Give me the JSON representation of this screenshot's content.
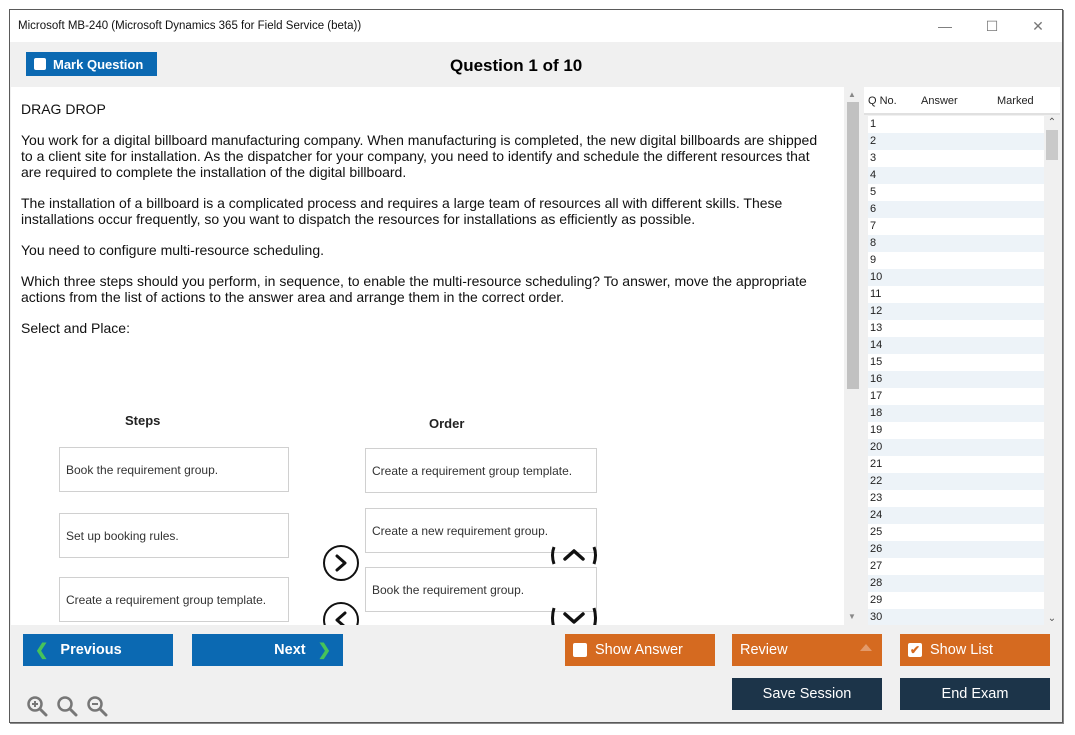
{
  "window": {
    "title": "Microsoft MB-240 (Microsoft Dynamics 365 for Field Service (beta))",
    "controls": {
      "minimize": "—",
      "maximize": "☐",
      "close": "✕"
    }
  },
  "header": {
    "mark_question_label": "Mark Question",
    "question_counter": "Question 1 of 10"
  },
  "question": {
    "type": "DRAG DROP",
    "paragraphs": [
      "You work for a digital billboard manufacturing company. When manufacturing is completed, the new digital billboards are shipped to a client site for installation. As the dispatcher for your company, you need to identify and schedule the different resources that are required to complete the installation of the digital billboard.",
      "The installation of a billboard is a complicated process and requires a large team of resources all with different skills. These installations occur frequently, so you want to dispatch the resources for installations as efficiently as possible.",
      "You need to configure multi-resource scheduling.",
      "Which three steps should you perform, in sequence, to enable the multi-resource scheduling? To answer, move the appropriate actions from the list of actions to the answer area and arrange them in the correct order.",
      "Select and Place:"
    ]
  },
  "drag_drop": {
    "steps_heading": "Steps",
    "order_heading": "Order",
    "steps": [
      "Book the requirement group.",
      "Set up booking rules.",
      "Create a requirement group template."
    ],
    "order": [
      "Create a requirement group template.",
      "Create a new requirement group.",
      "Book the requirement group."
    ]
  },
  "question_list": {
    "columns": [
      "Q No.",
      "Answer",
      "Marked"
    ],
    "rows": [
      "1",
      "2",
      "3",
      "4",
      "5",
      "6",
      "7",
      "8",
      "9",
      "10",
      "11",
      "12",
      "13",
      "14",
      "15",
      "16",
      "17",
      "18",
      "19",
      "20",
      "21",
      "22",
      "23",
      "24",
      "25",
      "26",
      "27",
      "28",
      "29",
      "30"
    ]
  },
  "footer": {
    "previous_label": "Previous",
    "next_label": "Next",
    "show_answer_label": "Show Answer",
    "show_answer_checked": false,
    "review_label": "Review",
    "show_list_label": "Show List",
    "show_list_checked": true,
    "save_session_label": "Save Session",
    "end_exam_label": "End Exam"
  },
  "colors": {
    "primary_blue": "#0b69b2",
    "orange": "#d56a20",
    "navy": "#1c3449",
    "chevron_green": "#46c35a"
  }
}
